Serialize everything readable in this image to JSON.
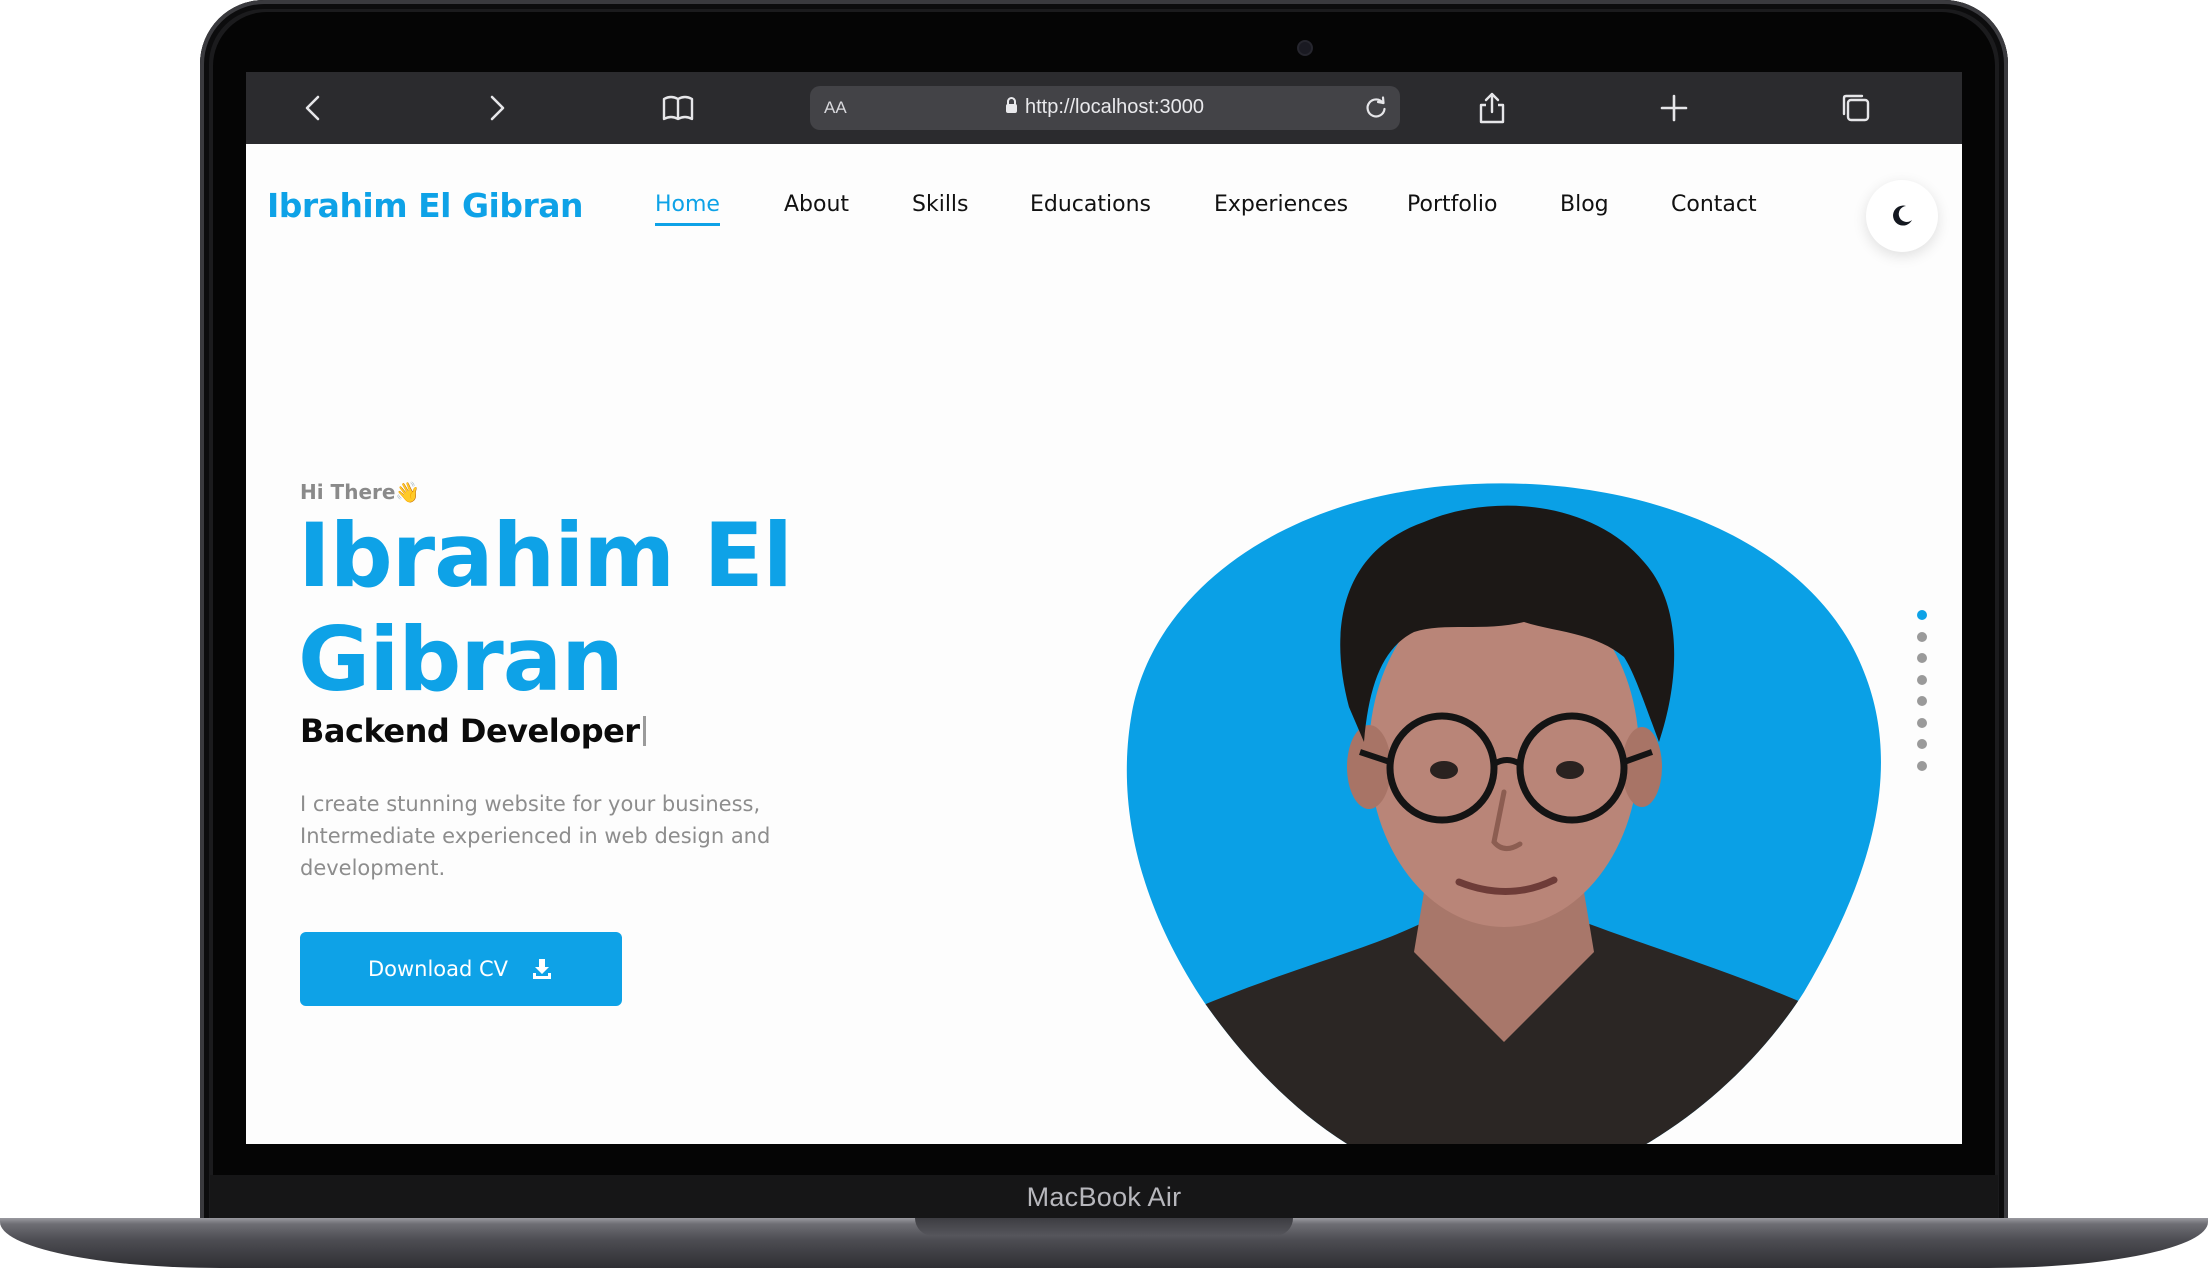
{
  "device": {
    "label": "MacBook Air"
  },
  "browser": {
    "text_size_label": "AA",
    "url": "http://localhost:3000",
    "icons": [
      "back-icon",
      "forward-icon",
      "bookmarks-icon",
      "lock-icon",
      "reload-icon",
      "share-icon",
      "new-tab-icon",
      "tabs-overview-icon"
    ]
  },
  "site": {
    "brand": "Ibrahim El Gibran",
    "nav": [
      {
        "label": "Home",
        "active": true
      },
      {
        "label": "About"
      },
      {
        "label": "Skills"
      },
      {
        "label": "Educations"
      },
      {
        "label": "Experiences"
      },
      {
        "label": "Portfolio"
      },
      {
        "label": "Blog"
      },
      {
        "label": "Contact"
      }
    ],
    "theme_toggle_icon": "moon-icon"
  },
  "hero": {
    "greeting": "Hi There👋",
    "name": "Ibrahim El Gibran",
    "role": "Backend Developer",
    "description": "I create stunning website for your business, Intermediate experienced in web design and development.",
    "cta_label": "Download CV",
    "cta_icon": "download-icon",
    "photo_icon": "profile-photo",
    "section_dots": {
      "count": 8,
      "active": 1
    }
  },
  "colors": {
    "accent": "#0ea2e7",
    "browser_toolbar": "#2b2b2e",
    "url_field": "#434347",
    "page_bg": "#fdfdfd"
  }
}
